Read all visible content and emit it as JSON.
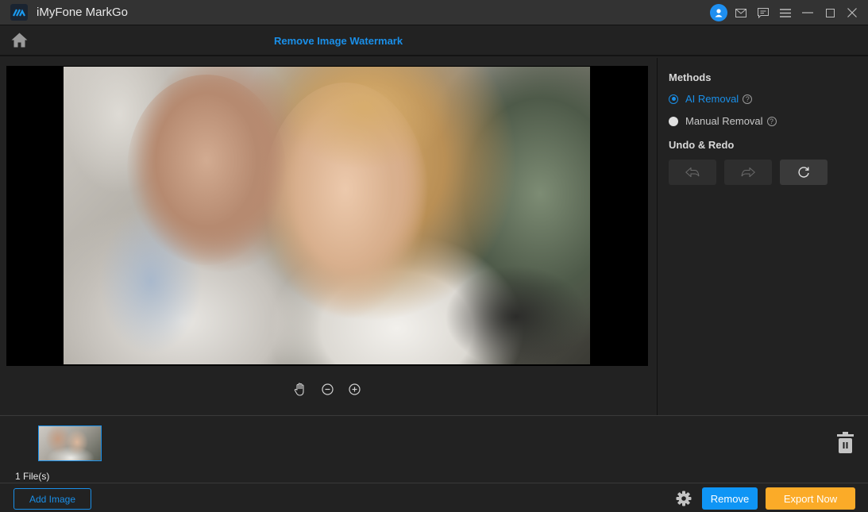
{
  "app": {
    "title": "iMyFone MarkGo",
    "logo_icon": "markgo-logo-icon"
  },
  "window_controls": [
    {
      "name": "account-icon"
    },
    {
      "name": "mail-icon"
    },
    {
      "name": "feedback-icon"
    },
    {
      "name": "menu-icon"
    },
    {
      "name": "minimize-icon"
    },
    {
      "name": "maximize-icon"
    },
    {
      "name": "close-icon"
    }
  ],
  "header": {
    "home_icon": "home-icon",
    "page_title": "Remove Image Watermark"
  },
  "canvas": {
    "image_description": "Grandmother and young girl looking at flowers",
    "tools": [
      {
        "name": "hand-icon",
        "label": "Pan"
      },
      {
        "name": "zoom-out-icon",
        "label": "Zoom out"
      },
      {
        "name": "zoom-in-icon",
        "label": "Zoom in"
      }
    ]
  },
  "side": {
    "methods_heading": "Methods",
    "methods": [
      {
        "label": "AI Removal",
        "selected": true
      },
      {
        "label": "Manual Removal",
        "selected": false
      }
    ],
    "help_glyph": "?",
    "undo_redo_heading": "Undo & Redo",
    "undo_label": "Undo",
    "redo_label": "Redo",
    "reset_label": "Reset"
  },
  "files": {
    "count_label": "1 File(s)"
  },
  "footer": {
    "add_image": "Add Image",
    "remove": "Remove",
    "export": "Export Now"
  },
  "colors": {
    "accent": "#1a8fe8",
    "remove_button": "#0f95f5",
    "export_button": "#fbab28",
    "background": "#222222",
    "titlebar": "#333333"
  }
}
